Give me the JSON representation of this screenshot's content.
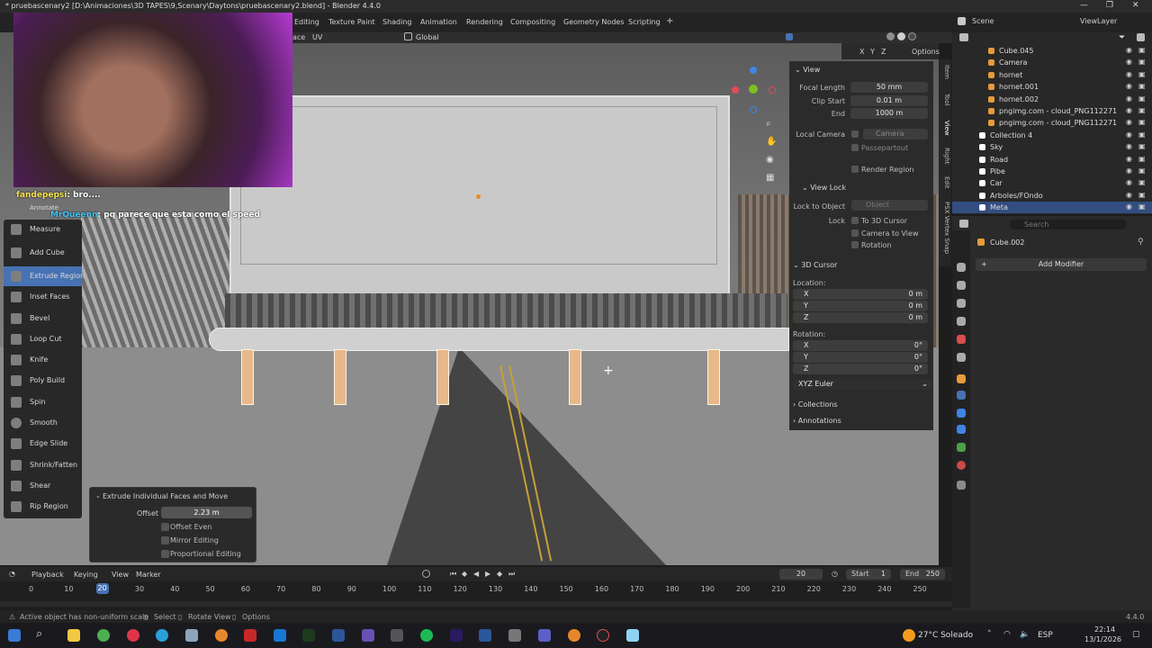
{
  "window": {
    "title": "* pruebascenary2 [D:\\Animaciones\\3D TAPES\\9,Scenary\\Daytons\\pruebascenary2.blend] - Blender 4.4.0",
    "controls": [
      "—",
      "❐",
      "✕"
    ]
  },
  "workspaces": [
    "Editing",
    "Texture Paint",
    "Shading",
    "Animation",
    "Rendering",
    "Compositing",
    "Geometry Nodes",
    "Scripting",
    "+"
  ],
  "scene": {
    "label": "Scene",
    "view_layer": "ViewLayer"
  },
  "viewport_header": {
    "face_label": "ace",
    "uv_label": "UV",
    "orientation": "Global",
    "options_label": "Options",
    "axes": [
      "X",
      "Y",
      "Z"
    ]
  },
  "chat": [
    {
      "user": "fandepepsi",
      "message": "bro...."
    },
    {
      "user": "MrQueenn",
      "message": "pq parece que esta como el speed"
    }
  ],
  "tools": {
    "annotate": "Annotate",
    "items": [
      "Measure",
      "Add Cube",
      "Extrude Region",
      "Inset Faces",
      "Bevel",
      "Loop Cut",
      "Knife",
      "Poly Build",
      "Spin",
      "Smooth",
      "Edge Slide",
      "Shrink/Fatten",
      "Shear",
      "Rip Region"
    ]
  },
  "operator": {
    "title": "Extrude Individual Faces and Move",
    "offset_label": "Offset",
    "offset_value": "2.23 m",
    "checks": [
      "Offset Even",
      "Mirror Editing",
      "Proportional Editing"
    ]
  },
  "npanel": {
    "view": {
      "header": "View",
      "focal_length_label": "Focal Length",
      "focal_length": "50 mm",
      "clip_start_label": "Clip Start",
      "clip_start": "0.01 m",
      "end_label": "End",
      "end": "1000 m",
      "local_camera_label": "Local Camera",
      "local_camera": "Camera",
      "passepartout": "Passepartout",
      "render_region": "Render Region"
    },
    "view_lock": {
      "header": "View Lock",
      "lock_to_object_label": "Lock to Object",
      "lock_to_object": "Object",
      "lock_label": "Lock",
      "to_3d_cursor": "To 3D Cursor",
      "camera_to_view": "Camera to View",
      "rotation": "Rotation"
    },
    "cursor": {
      "header": "3D Cursor",
      "location_label": "Location:",
      "loc": [
        {
          "axis": "X",
          "value": "0 m"
        },
        {
          "axis": "Y",
          "value": "0 m"
        },
        {
          "axis": "Z",
          "value": "0 m"
        }
      ],
      "rotation_label": "Rotation:",
      "rot": [
        {
          "axis": "X",
          "value": "0°"
        },
        {
          "axis": "Y",
          "value": "0°"
        },
        {
          "axis": "Z",
          "value": "0°"
        }
      ],
      "mode": "XYZ Euler"
    },
    "collections": "Collections",
    "annotations": "Annotations",
    "tabs": [
      "Item",
      "Tool",
      "View",
      "Right",
      "Edit",
      "PSX Vertex Snap"
    ]
  },
  "outliner": {
    "items": [
      {
        "name": "Cube.045",
        "indent": 2,
        "color": "#e79a3b"
      },
      {
        "name": "Camera",
        "indent": 2,
        "color": "#e79a3b"
      },
      {
        "name": "hornet",
        "indent": 2,
        "color": "#e79a3b"
      },
      {
        "name": "hornet.001",
        "indent": 2,
        "color": "#e79a3b"
      },
      {
        "name": "hornet.002",
        "indent": 2,
        "color": "#e79a3b"
      },
      {
        "name": "pngimg.com - cloud_PNG112271",
        "indent": 2,
        "color": "#e79a3b"
      },
      {
        "name": "pngimg.com - cloud_PNG112271",
        "indent": 2,
        "color": "#e79a3b"
      },
      {
        "name": "Collection 4",
        "indent": 1,
        "color": "#ffffff"
      },
      {
        "name": "Sky",
        "indent": 1,
        "color": "#ffffff"
      },
      {
        "name": "Road",
        "indent": 1,
        "color": "#ffffff"
      },
      {
        "name": "Pibe",
        "indent": 1,
        "color": "#ffffff"
      },
      {
        "name": "Car",
        "indent": 1,
        "color": "#ffffff"
      },
      {
        "name": "Arboles/FOndo",
        "indent": 1,
        "color": "#ffffff"
      },
      {
        "name": "Meta",
        "indent": 1,
        "color": "#ffffff"
      }
    ]
  },
  "properties": {
    "object_name": "Cube.002",
    "add_modifier": "Add Modifier",
    "search_placeholder": "Search"
  },
  "timeline": {
    "menus": [
      "Playback",
      "Keying",
      "View",
      "Marker"
    ],
    "current_frame": "20",
    "start_label": "Start",
    "start": "1",
    "end_label": "End",
    "end": "250",
    "ticks": [
      "0",
      "10",
      "20",
      "30",
      "40",
      "50",
      "60",
      "70",
      "80",
      "90",
      "100",
      "110",
      "120",
      "130",
      "140",
      "150",
      "160",
      "170",
      "180",
      "190",
      "200",
      "210",
      "220",
      "230",
      "240",
      "250"
    ],
    "playhead": "20"
  },
  "status": {
    "message": "Active object has non-uniform scale",
    "select": "Select",
    "rotate_view": "Rotate View",
    "options": "Options",
    "version": "4.4.0"
  },
  "taskbar": {
    "weather": "27°C Soleado",
    "language": "ESP",
    "time": "22:14",
    "date": "13/1/2026"
  },
  "colors": {
    "accent": "#4772b3",
    "selected_orange": "#e7b98a",
    "outliner_bg": "#282828"
  }
}
